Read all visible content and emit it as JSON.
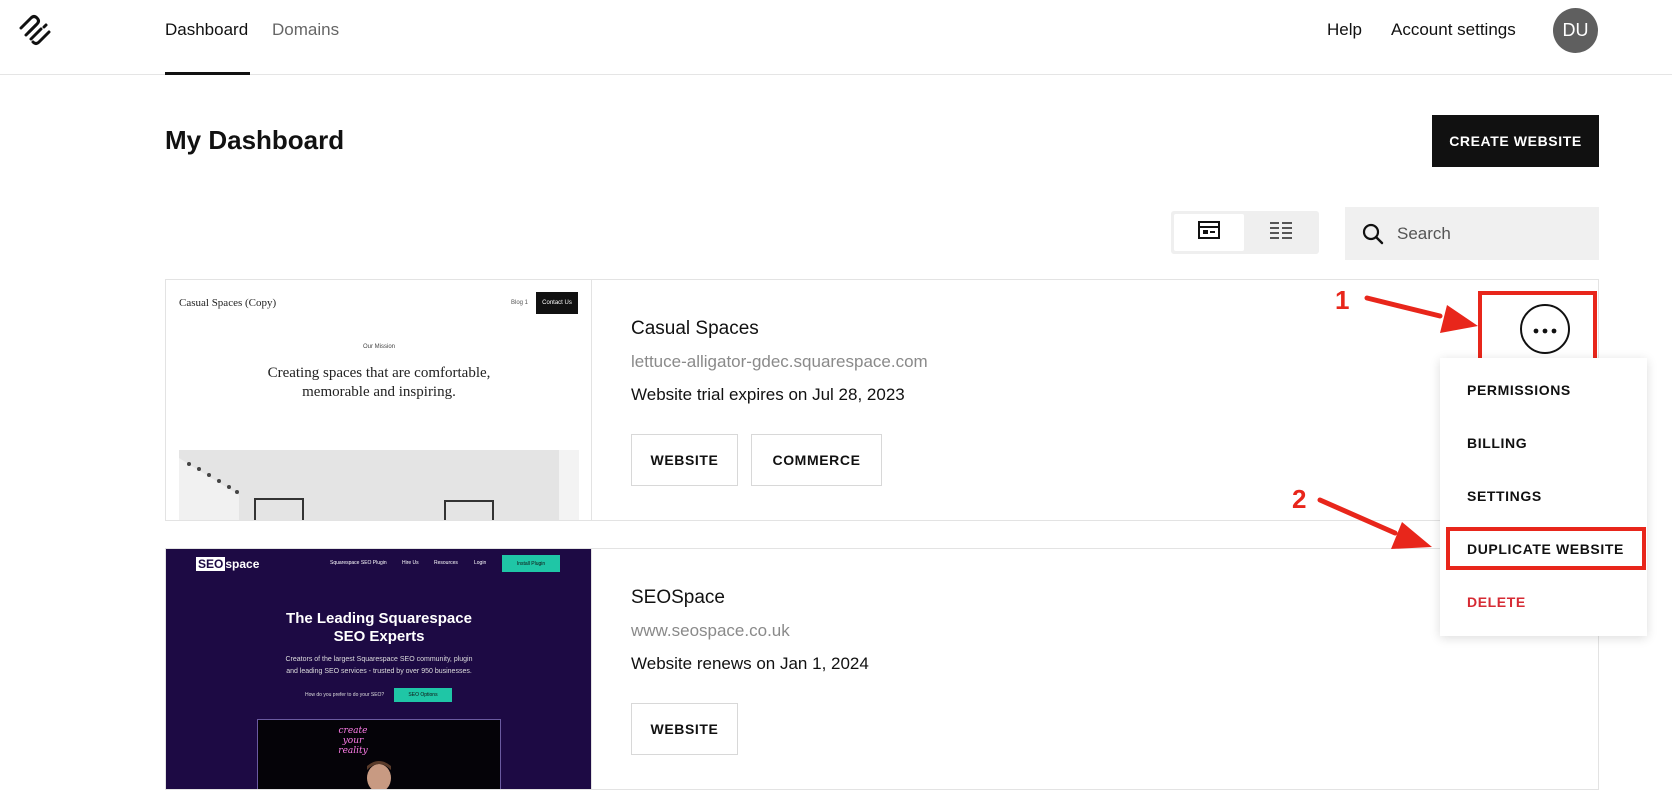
{
  "nav": {
    "tabs": [
      {
        "label": "Dashboard",
        "active": true
      },
      {
        "label": "Domains",
        "active": false
      }
    ],
    "help": "Help",
    "account_settings": "Account settings",
    "avatar_initials": "DU"
  },
  "header": {
    "title": "My Dashboard",
    "create_button": "CREATE WEBSITE"
  },
  "toolbar": {
    "view_modes": [
      "grid-view-icon",
      "list-view-icon"
    ],
    "active_view": "grid",
    "search_placeholder": "Search"
  },
  "sites": [
    {
      "name": "Casual Spaces",
      "url": "lettuce-alligator-gdec.squarespace.com",
      "status": "Website trial expires on Jul 28, 2023",
      "buttons": [
        "WEBSITE",
        "COMMERCE"
      ],
      "preview": {
        "title": "Casual Spaces (Copy)",
        "nav_link": "Blog 1",
        "nav_button": "Contact Us",
        "eyebrow": "Our Mission",
        "headline": "Creating spaces that are comfortable, memorable and inspiring."
      }
    },
    {
      "name": "SEOSpace",
      "url": "www.seospace.co.uk",
      "status": "Website renews on Jan 1, 2024",
      "buttons": [
        "WEBSITE"
      ],
      "preview": {
        "logo_a": "SEO",
        "logo_b": "space",
        "nav": [
          "Squarespace SEO Plugin",
          "Hire Us",
          "Resources",
          "Login"
        ],
        "nav_button": "Install Plugin",
        "headline_1": "The Leading Squarespace",
        "headline_2": "SEO Experts",
        "sub_1": "Creators of the largest Squarespace SEO community, plugin",
        "sub_2": "and leading SEO services - trusted by over 950 businesses.",
        "prefer": "How do you prefer to do your SEO?",
        "options": "SEO Options",
        "neon_text": "create your reality"
      }
    }
  ],
  "menu": {
    "more_icon": "ellipsis-icon",
    "items": [
      {
        "label": "PERMISSIONS"
      },
      {
        "label": "BILLING"
      },
      {
        "label": "SETTINGS"
      },
      {
        "label": "DUPLICATE WEBSITE"
      },
      {
        "label": "DELETE",
        "danger": true
      }
    ]
  },
  "annotations": {
    "step_1": "1",
    "step_2": "2",
    "color": "#e8261b"
  }
}
